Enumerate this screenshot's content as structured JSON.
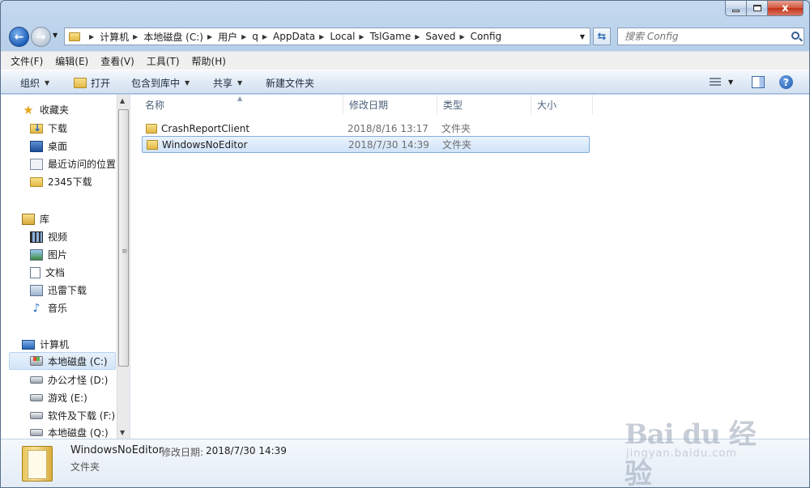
{
  "window": {
    "close_glyph": "x"
  },
  "address": {
    "breadcrumbs": [
      "计算机",
      "本地磁盘 (C:)",
      "用户",
      "q",
      "AppData",
      "Local",
      "TslGame",
      "Saved",
      "Config"
    ]
  },
  "search": {
    "placeholder": "搜索 Config"
  },
  "menubar": {
    "items": [
      "文件(F)",
      "编辑(E)",
      "查看(V)",
      "工具(T)",
      "帮助(H)"
    ]
  },
  "toolbar": {
    "organize": "组织",
    "open": "打开",
    "include_library": "包含到库中",
    "share": "共享",
    "new_folder": "新建文件夹",
    "help_glyph": "?"
  },
  "sidebar": {
    "favorites": {
      "label": "收藏夹",
      "items": [
        "下载",
        "桌面",
        "最近访问的位置",
        "2345下载"
      ]
    },
    "libraries": {
      "label": "库",
      "items": [
        "视频",
        "图片",
        "文档",
        "迅雷下载",
        "音乐"
      ]
    },
    "computer": {
      "label": "计算机",
      "items": [
        "本地磁盘 (C:)",
        "办公才怪 (D:)",
        "游戏 (E:)",
        "软件及下载 (F:)",
        "本地磁盘 (Q:)"
      ]
    }
  },
  "columns": {
    "name": "名称",
    "date": "修改日期",
    "type": "类型",
    "size": "大小"
  },
  "files": [
    {
      "name": "CrashReportClient",
      "date": "2018/8/16 13:17",
      "type": "文件夹"
    },
    {
      "name": "WindowsNoEditor",
      "date": "2018/7/30 14:39",
      "type": "文件夹"
    }
  ],
  "details": {
    "name": "WindowsNoEditor",
    "modified_label": "修改日期:",
    "modified_value": "2018/7/30 14:39",
    "type": "文件夹"
  },
  "watermark": {
    "logo": "Bai du 经验",
    "url": "jingyan.baidu.com"
  }
}
